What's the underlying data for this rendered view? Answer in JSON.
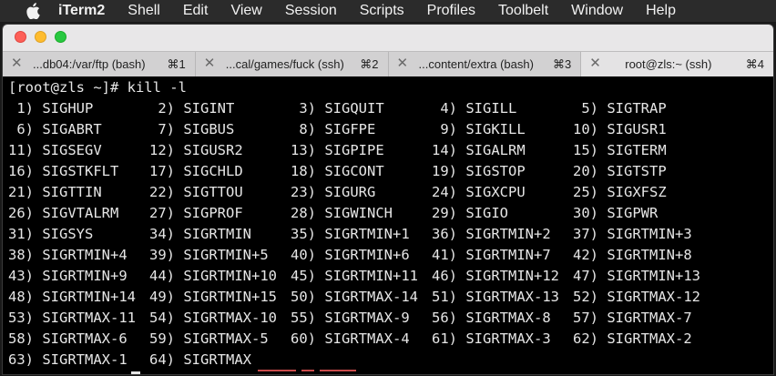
{
  "menubar": {
    "apple_icon": "apple-logo-icon",
    "items": [
      "iTerm2",
      "Shell",
      "Edit",
      "View",
      "Session",
      "Scripts",
      "Profiles",
      "Toolbelt",
      "Window",
      "Help"
    ]
  },
  "window": {
    "tabs": [
      {
        "title": "...db04:/var/ftp (bash)",
        "shortcut": "⌘1",
        "active": false
      },
      {
        "title": "...cal/games/fuck (ssh)",
        "shortcut": "⌘2",
        "active": false
      },
      {
        "title": "...content/extra (bash)",
        "shortcut": "⌘3",
        "active": false
      },
      {
        "title": "root@zls:~ (ssh)",
        "shortcut": "⌘4",
        "active": true
      }
    ],
    "close_glyph": "✕"
  },
  "terminal": {
    "prompt": "[root@zls ~]# kill -l",
    "signals": [
      " 1) SIGHUP",
      " 2) SIGINT",
      " 3) SIGQUIT",
      " 4) SIGILL",
      " 5) SIGTRAP",
      " 6) SIGABRT",
      " 7) SIGBUS",
      " 8) SIGFPE",
      " 9) SIGKILL",
      "10) SIGUSR1",
      "11) SIGSEGV",
      "12) SIGUSR2",
      "13) SIGPIPE",
      "14) SIGALRM",
      "15) SIGTERM",
      "16) SIGSTKFLT",
      "17) SIGCHLD",
      "18) SIGCONT",
      "19) SIGSTOP",
      "20) SIGTSTP",
      "21) SIGTTIN",
      "22) SIGTTOU",
      "23) SIGURG",
      "24) SIGXCPU",
      "25) SIGXFSZ",
      "26) SIGVTALRM",
      "27) SIGPROF",
      "28) SIGWINCH",
      "29) SIGIO",
      "30) SIGPWR",
      "31) SIGSYS",
      "34) SIGRTMIN",
      "35) SIGRTMIN+1",
      "36) SIGRTMIN+2",
      "37) SIGRTMIN+3",
      "38) SIGRTMIN+4",
      "39) SIGRTMIN+5",
      "40) SIGRTMIN+6",
      "41) SIGRTMIN+7",
      "42) SIGRTMIN+8",
      "43) SIGRTMIN+9",
      "44) SIGRTMIN+10",
      "45) SIGRTMIN+11",
      "46) SIGRTMIN+12",
      "47) SIGRTMIN+13",
      "48) SIGRTMIN+14",
      "49) SIGRTMIN+15",
      "50) SIGRTMAX-14",
      "51) SIGRTMAX-13",
      "52) SIGRTMAX-12",
      "53) SIGRTMAX-11",
      "54) SIGRTMAX-10",
      "55) SIGRTMAX-9",
      "56) SIGRTMAX-8",
      "57) SIGRTMAX-7",
      "58) SIGRTMAX-6",
      "59) SIGRTMAX-5",
      "60) SIGRTMAX-4",
      "61) SIGRTMAX-3",
      "62) SIGRTMAX-2",
      "63) SIGRTMAX-1",
      "64) SIGRTMAX"
    ]
  }
}
